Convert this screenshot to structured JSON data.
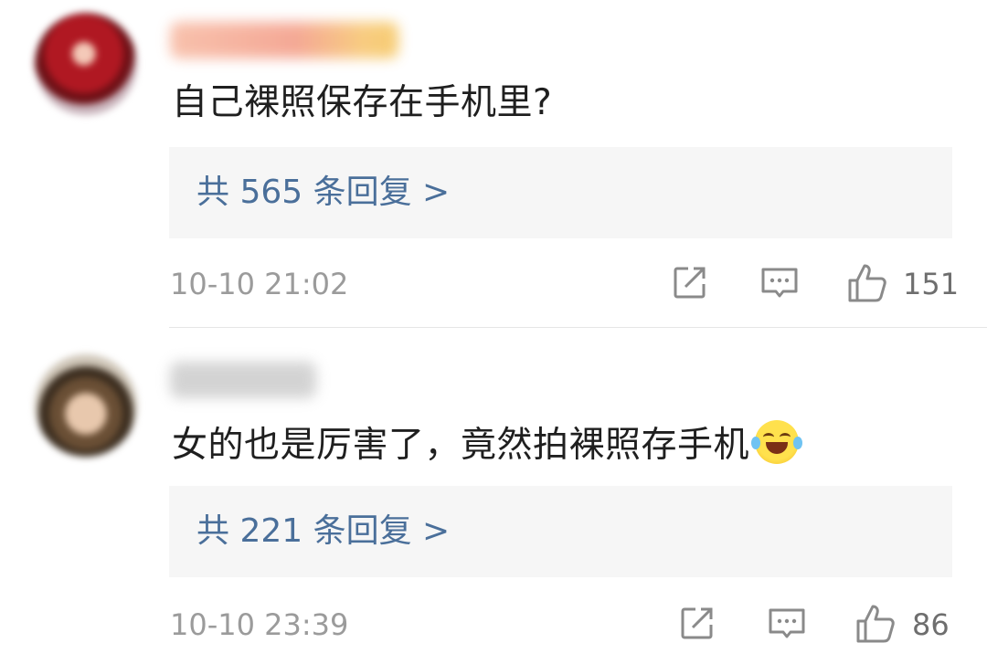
{
  "comments": [
    {
      "username": "",
      "text": "自己裸照保存在手机里?",
      "replies_label": "共 565 条回复 >",
      "time": "10-10 21:02",
      "likes": "151",
      "icons": {
        "repost": "repost-icon",
        "comment": "comment-icon",
        "like": "thumbs-up-icon"
      }
    },
    {
      "username": "",
      "text": "女的也是厉害了，竟然拍裸照存手机",
      "emoji": "laughing-tears-emoji",
      "replies_label": "共 221 条回复 >",
      "time": "10-10 23:39",
      "likes": "86",
      "icons": {
        "repost": "repost-icon",
        "comment": "comment-icon",
        "like": "thumbs-up-icon"
      }
    }
  ],
  "colors": {
    "reply_link": "#4a6f9a",
    "meta_gray": "#9b9b9b",
    "reply_bg": "#f6f6f6",
    "text": "#1f1f1f"
  }
}
